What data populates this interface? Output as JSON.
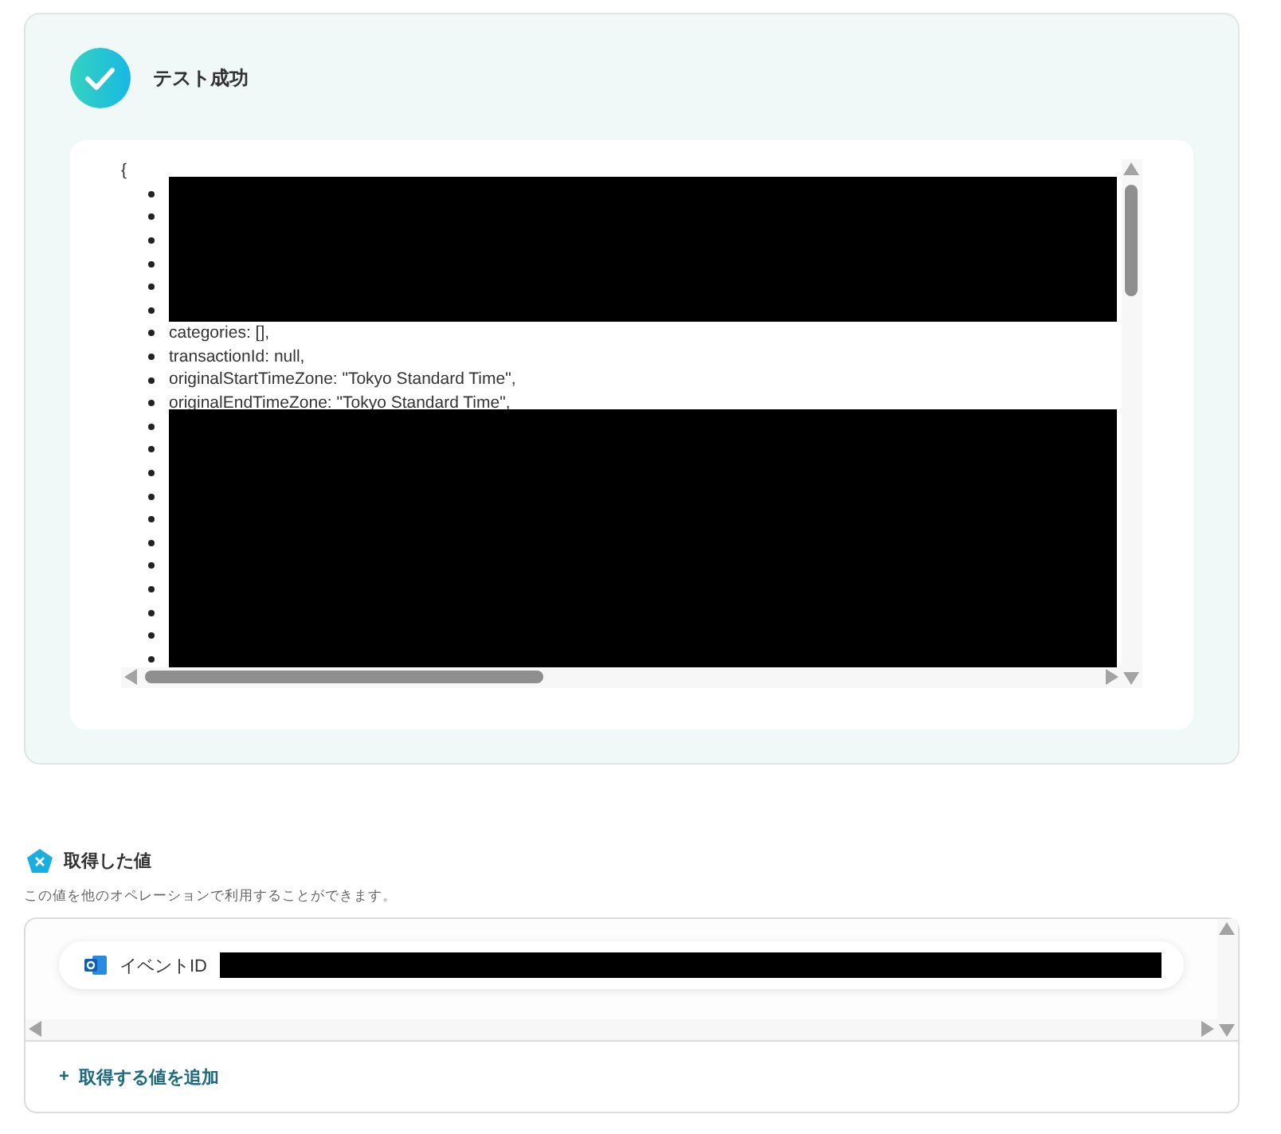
{
  "result": {
    "succeeded": true,
    "title": "テスト成功",
    "code": {
      "open_brace": "{",
      "lines": [
        {
          "kind": "masked"
        },
        {
          "kind": "masked"
        },
        {
          "kind": "masked"
        },
        {
          "kind": "masked"
        },
        {
          "kind": "masked"
        },
        {
          "kind": "masked"
        },
        {
          "kind": "text",
          "text": "categories: [],"
        },
        {
          "kind": "text",
          "text": "transactionId: null,"
        },
        {
          "kind": "text",
          "text": "originalStartTimeZone: \"Tokyo Standard Time\","
        },
        {
          "kind": "text",
          "text": "originalEndTimeZone: \"Tokyo Standard Time\","
        },
        {
          "kind": "masked"
        },
        {
          "kind": "masked"
        },
        {
          "kind": "masked"
        },
        {
          "kind": "masked"
        },
        {
          "kind": "masked"
        },
        {
          "kind": "masked"
        },
        {
          "kind": "masked"
        },
        {
          "kind": "masked"
        },
        {
          "kind": "masked"
        },
        {
          "kind": "masked"
        },
        {
          "kind": "masked"
        }
      ]
    }
  },
  "values": {
    "title": "取得した値",
    "description": "この値を他のオペレーションで利用することができます。",
    "items": [
      {
        "label": "イベントID",
        "value_masked": true
      }
    ],
    "add_link": {
      "icon": "+",
      "label": "取得する値を追加"
    }
  }
}
